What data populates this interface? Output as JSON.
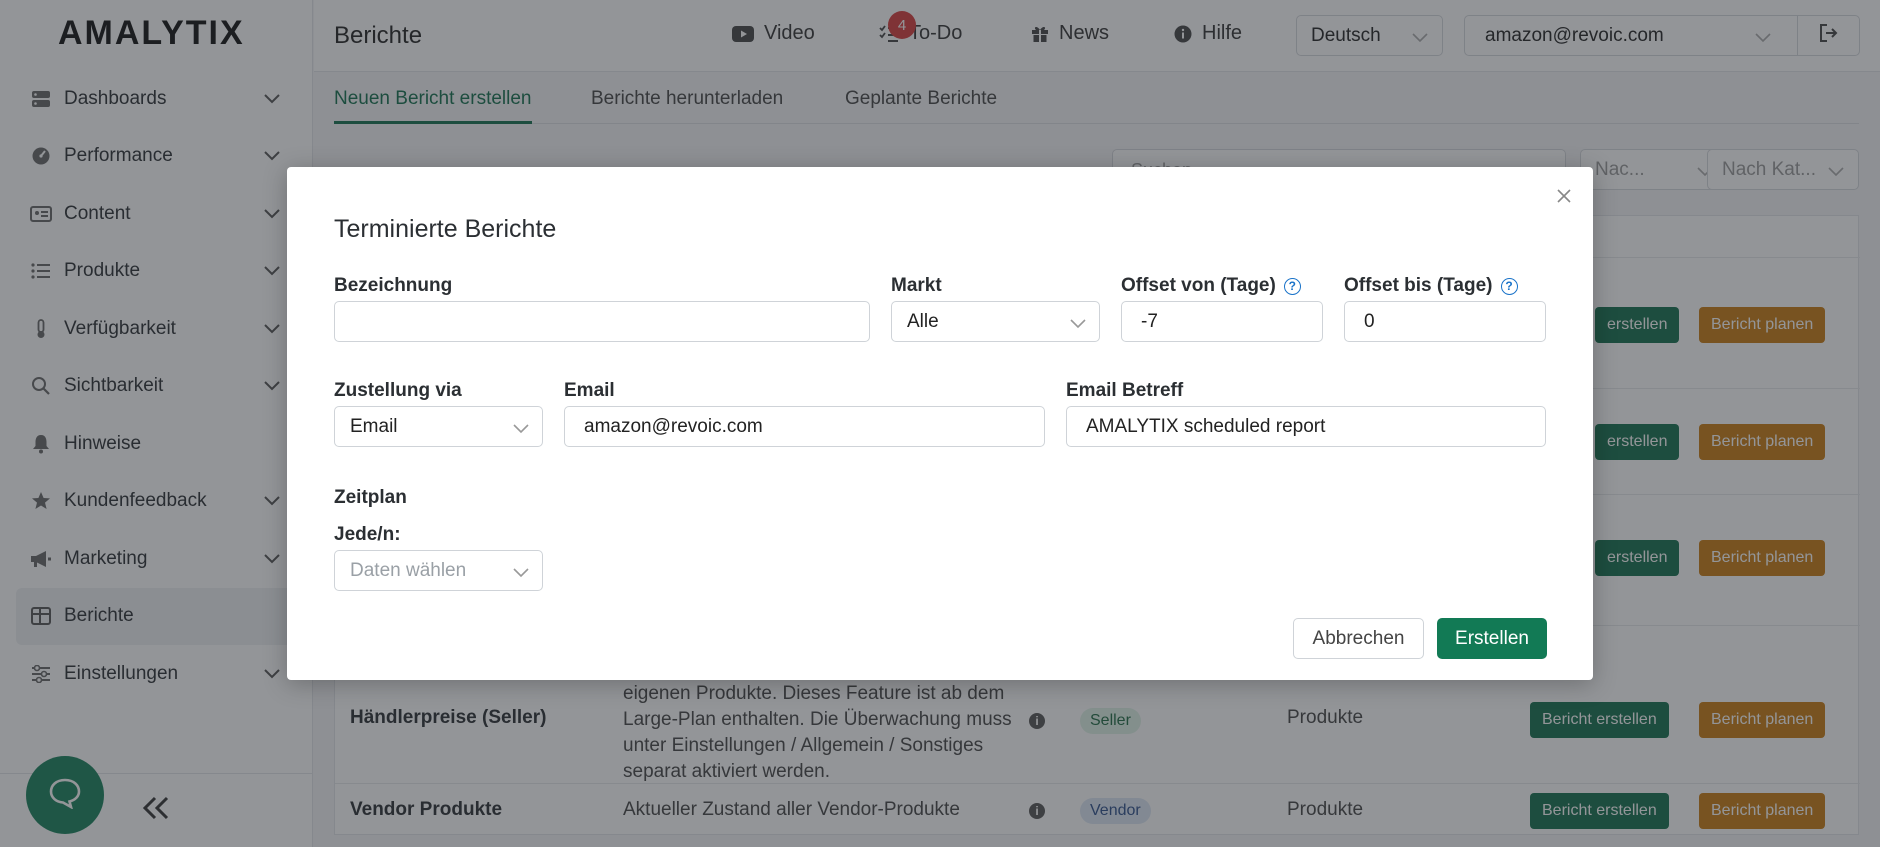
{
  "brand": {
    "logo_text": "AMALYTIX",
    "accent": "#126f4c"
  },
  "sidebar": {
    "items": [
      {
        "label": "Dashboards",
        "icon": "dashboard-icon",
        "expandable": true
      },
      {
        "label": "Performance",
        "icon": "gauge-icon",
        "expandable": true
      },
      {
        "label": "Content",
        "icon": "id-card-icon",
        "expandable": true
      },
      {
        "label": "Produkte",
        "icon": "list-icon",
        "expandable": true
      },
      {
        "label": "Verfügbarkeit",
        "icon": "thermometer-icon",
        "expandable": true
      },
      {
        "label": "Sichtbarkeit",
        "icon": "search-icon",
        "expandable": true
      },
      {
        "label": "Hinweise",
        "icon": "bell-icon",
        "expandable": false
      },
      {
        "label": "Kundenfeedback",
        "icon": "star-icon",
        "expandable": true
      },
      {
        "label": "Marketing",
        "icon": "megaphone-icon",
        "expandable": true
      },
      {
        "label": "Berichte",
        "icon": "table-icon",
        "expandable": false,
        "active": true
      },
      {
        "label": "Einstellungen",
        "icon": "sliders-icon",
        "expandable": true
      }
    ]
  },
  "header": {
    "title": "Berichte",
    "links": {
      "video": "Video",
      "todo": "To-Do",
      "news": "News",
      "help": "Hilfe"
    },
    "todo_badge": "4",
    "language": "Deutsch",
    "account": "amazon@revoic.com"
  },
  "tabs": [
    {
      "label": "Neuen Bericht erstellen",
      "active": true
    },
    {
      "label": "Berichte herunterladen"
    },
    {
      "label": "Geplante Berichte"
    }
  ],
  "background": {
    "search_placeholder": "Suchen",
    "filter_market": "Nac...",
    "filter_category": "Nach Kat...",
    "button_create": "Bericht erstellen",
    "button_create_cropped": "erstellen",
    "button_plan": "Bericht planen",
    "rows": [
      {
        "name": "Händlerpreise (Seller)",
        "desc_lines": [
          "eigenen Produkte. Dieses Feature ist ab dem",
          "Large-Plan enthalten. Die Überwachung muss",
          "unter Einstellungen / Allgemein / Sonstiges",
          "separat aktiviert werden."
        ],
        "type": "Seller",
        "category": "Produkte"
      },
      {
        "name": "Vendor Produkte",
        "desc_lines": [
          "Aktueller Zustand aller Vendor-Produkte"
        ],
        "type": "Vendor",
        "category": "Produkte"
      }
    ]
  },
  "modal": {
    "title": "Terminierte Berichte",
    "fields": {
      "bezeichnung": {
        "label": "Bezeichnung",
        "value": ""
      },
      "markt": {
        "label": "Markt",
        "value": "Alle"
      },
      "offset_von": {
        "label": "Offset von (Tage)",
        "value": "-7"
      },
      "offset_bis": {
        "label": "Offset bis (Tage)",
        "value": "0"
      },
      "zustellung": {
        "label": "Zustellung via",
        "value": "Email"
      },
      "email": {
        "label": "Email",
        "value": "amazon@revoic.com"
      },
      "email_betreff": {
        "label": "Email Betreff",
        "value": "AMALYTIX scheduled report"
      }
    },
    "schedule": {
      "heading": "Zeitplan",
      "every_label": "Jede/n:",
      "placeholder": "Daten wählen"
    },
    "buttons": {
      "cancel": "Abbrechen",
      "create": "Erstellen"
    }
  }
}
